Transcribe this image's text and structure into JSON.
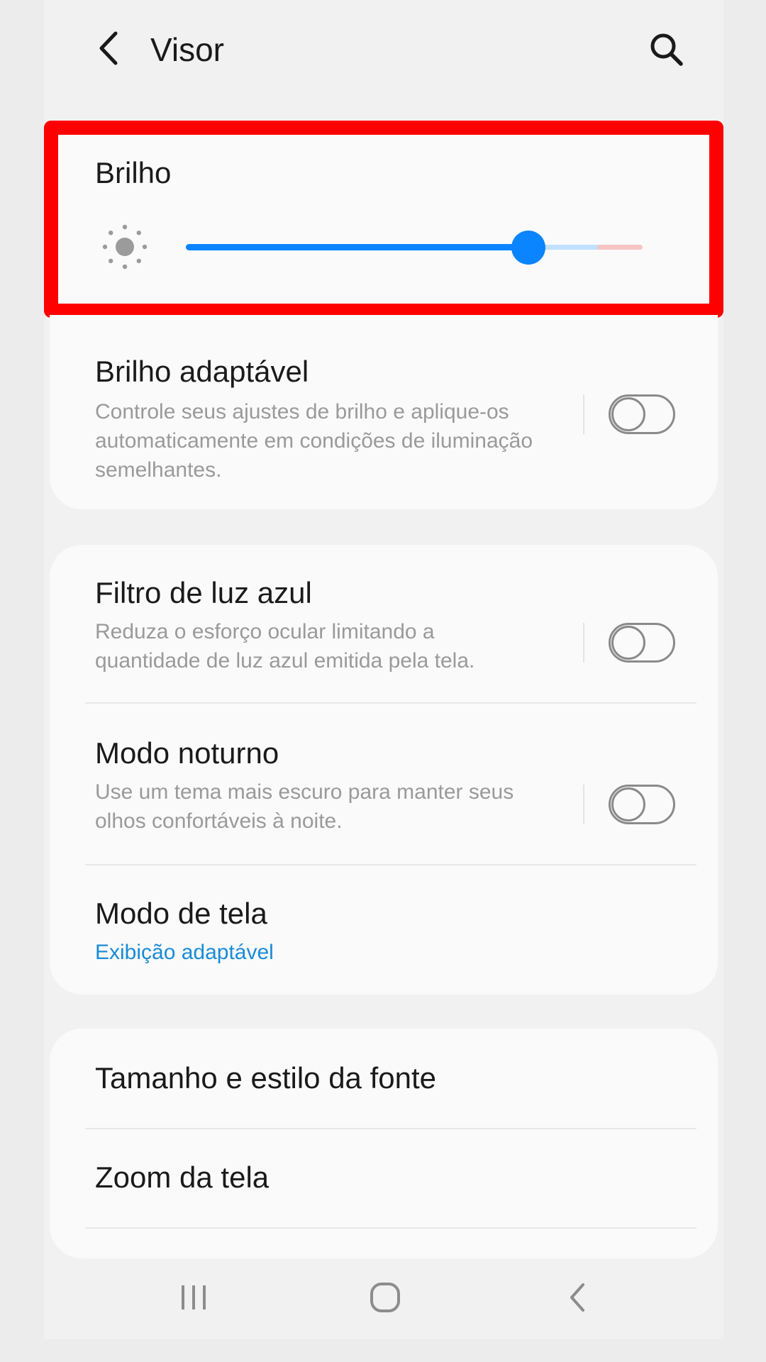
{
  "header": {
    "title": "Visor",
    "back_icon": "back-arrow-icon",
    "search_icon": "search-icon"
  },
  "brightness": {
    "label": "Brilho",
    "icon": "sun-icon",
    "level": 0.75,
    "accent_color": "#0a84ff"
  },
  "adaptive_brightness": {
    "title": "Brilho adaptável",
    "description": "Controle seus ajustes de brilho e aplique-os automaticamente em condições de iluminação semelhantes.",
    "enabled": false
  },
  "blue_light_filter": {
    "title": "Filtro de luz azul",
    "description": "Reduza o esforço ocular limitando a quantidade de luz azul emitida pela tela.",
    "enabled": false
  },
  "night_mode": {
    "title": "Modo noturno",
    "description": "Use um tema mais escuro para manter seus olhos confortáveis à noite.",
    "enabled": false
  },
  "screen_mode": {
    "title": "Modo de tela",
    "value": "Exibição adaptável"
  },
  "font_size": {
    "title": "Tamanho e estilo da fonte"
  },
  "screen_zoom": {
    "title": "Zoom da tela"
  },
  "navbar": {
    "recents_icon": "recents-icon",
    "home_icon": "home-icon",
    "back_icon": "nav-back-icon"
  },
  "highlight_color": "#ff0000"
}
